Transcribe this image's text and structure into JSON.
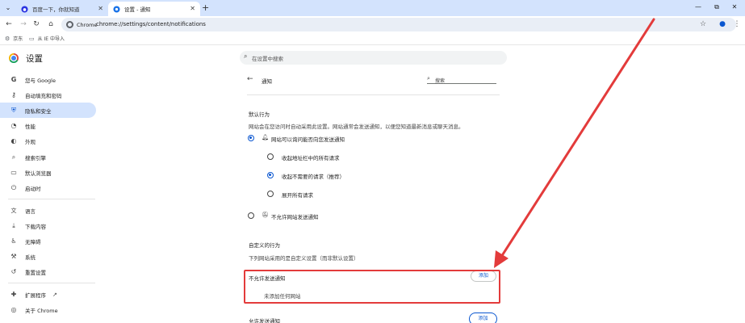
{
  "tabs": [
    {
      "label": "百度一下，你就知道",
      "close": "✕"
    },
    {
      "label": "设置 - 通知",
      "close": "✕"
    }
  ],
  "new_tab_label": "+",
  "window_controls": {
    "minimize": "—",
    "maximize": "⧉",
    "close": "✕"
  },
  "toolbar": {
    "back": "←",
    "forward": "→",
    "reload": "↻",
    "home": "⌂",
    "site_chip": "Chrome",
    "url": "chrome://settings/content/notifications",
    "bookmark_star": "☆",
    "profile": "●",
    "menu": "⋮"
  },
  "bookmarks": [
    {
      "icon": "⚙",
      "label": "京东"
    },
    {
      "icon": "▭",
      "label": "从 IE 中导入"
    }
  ],
  "settings": {
    "title": "设置",
    "search_placeholder": "在设置中搜索"
  },
  "sidebar": {
    "items": [
      {
        "icon": "G",
        "label": "您与 Google"
      },
      {
        "icon": "⚷",
        "label": "自动填充和密码"
      },
      {
        "icon": "⛨",
        "label": "隐私和安全"
      },
      {
        "icon": "◔",
        "label": "性能"
      },
      {
        "icon": "◐",
        "label": "外观"
      },
      {
        "icon": "⌕",
        "label": "搜索引擎"
      },
      {
        "icon": "▭",
        "label": "默认浏览器"
      },
      {
        "icon": "⏻",
        "label": "启动时"
      },
      {
        "icon": "文",
        "label": "语言"
      },
      {
        "icon": "⤓",
        "label": "下载内容"
      },
      {
        "icon": "♿",
        "label": "无障碍"
      },
      {
        "icon": "⚒",
        "label": "系统"
      },
      {
        "icon": "↺",
        "label": "重置设置"
      },
      {
        "icon": "✚",
        "label": "扩展程序"
      },
      {
        "icon": "◎",
        "label": "关于 Chrome"
      }
    ],
    "ext_link_icon": "↗"
  },
  "content": {
    "back_icon": "←",
    "page_title": "通知",
    "search_placeholder": "搜索",
    "default_behavior_heading": "默认行为",
    "default_behavior_desc": "网站会在您访问时自动采用此设置。网站通常会发送通知，以便您知道最新消息或聊天消息。",
    "allow_option": "网站可以询问能否向您发送通知",
    "sub_options": [
      "收起地址栏中的所有请求",
      "收起不需要的请求（推荐）",
      "展开所有请求"
    ],
    "block_option": "不允许网站发送通知",
    "custom_heading": "自定义的行为",
    "custom_desc": "下列网站采用的是自定义设置（而非默认设置）",
    "not_allowed_heading": "不允许发送通知",
    "not_allowed_empty": "未添加任何网站",
    "allowed_heading": "允许发送通知",
    "add_label": "添加"
  },
  "colors": {
    "accent": "#0b57d0",
    "highlight": "#e33b3b",
    "tabbar": "#d3e3fd"
  }
}
